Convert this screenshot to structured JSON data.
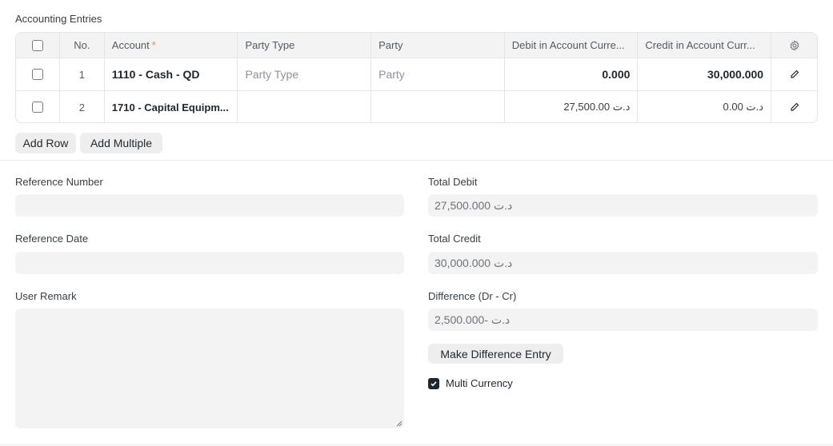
{
  "section_title": "Accounting Entries",
  "table": {
    "headers": {
      "no": "No.",
      "account": "Account",
      "required_mark": "*",
      "party_type": "Party Type",
      "party": "Party",
      "debit": "Debit in Account Curre...",
      "credit": "Credit in Account Curr..."
    },
    "rows": [
      {
        "no": "1",
        "account": "1110 - Cash - QD",
        "party_type": "Party Type",
        "party": "Party",
        "debit": "0.000",
        "credit": "30,000.000"
      },
      {
        "no": "2",
        "account": "1710 - Capital Equipm...",
        "party_type": "",
        "party": "",
        "debit": "د.ت 27,500.00",
        "credit": "د.ت 0.00"
      }
    ]
  },
  "buttons": {
    "add_row": "Add Row",
    "add_multiple": "Add Multiple",
    "make_difference_entry": "Make Difference Entry"
  },
  "form": {
    "reference_number_label": "Reference Number",
    "reference_number_value": "",
    "reference_date_label": "Reference Date",
    "reference_date_value": "",
    "user_remark_label": "User Remark",
    "user_remark_value": "",
    "total_debit_label": "Total Debit",
    "total_debit_value": "د.ت 27,500.000",
    "total_credit_label": "Total Credit",
    "total_credit_value": "د.ت 30,000.000",
    "difference_label": "Difference (Dr - Cr)",
    "difference_value": "د.ت -2,500.000",
    "multi_currency_label": "Multi Currency",
    "multi_currency_checked": true
  },
  "icons": {
    "settings": "gear-icon",
    "edit": "pencil-icon",
    "checkbox": "checkbox-icon"
  }
}
